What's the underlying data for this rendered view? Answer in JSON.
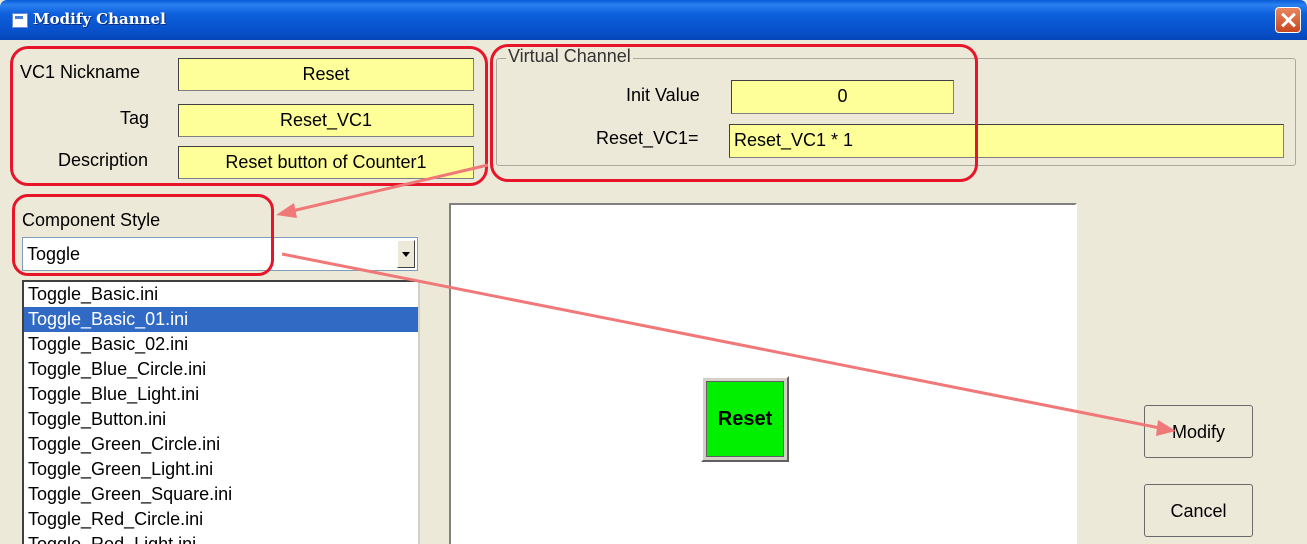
{
  "window": {
    "title": "Modify Channel"
  },
  "fields": {
    "nickname_label": "VC1 Nickname",
    "nickname_value": "Reset",
    "tag_label": "Tag",
    "tag_value": "Reset_VC1",
    "description_label": "Description",
    "description_value": "Reset button of Counter1"
  },
  "virtual_channel": {
    "legend": "Virtual Channel",
    "init_label": "Init Value",
    "init_value": "0",
    "expr_label": "Reset_VC1=",
    "expr_value": "Reset_VC1 * 1"
  },
  "component_style": {
    "label": "Component Style",
    "selected": "Toggle"
  },
  "style_list": {
    "items": [
      "Toggle_Basic.ini",
      "Toggle_Basic_01.ini",
      "Toggle_Basic_02.ini",
      "Toggle_Blue_Circle.ini",
      "Toggle_Blue_Light.ini",
      "Toggle_Button.ini",
      "Toggle_Green_Circle.ini",
      "Toggle_Green_Light.ini",
      "Toggle_Green_Square.ini",
      "Toggle_Red_Circle.ini",
      "Toggle_Red_Light.ini"
    ],
    "selected_index": 1
  },
  "preview": {
    "component_label": "Reset"
  },
  "buttons": {
    "modify": "Modify",
    "cancel": "Cancel"
  },
  "colors": {
    "field_bg": "#ffff99",
    "annotation": "#e8142a",
    "arrow": "#f07878",
    "selection": "#316ac5",
    "preview_component": "#00f000"
  }
}
